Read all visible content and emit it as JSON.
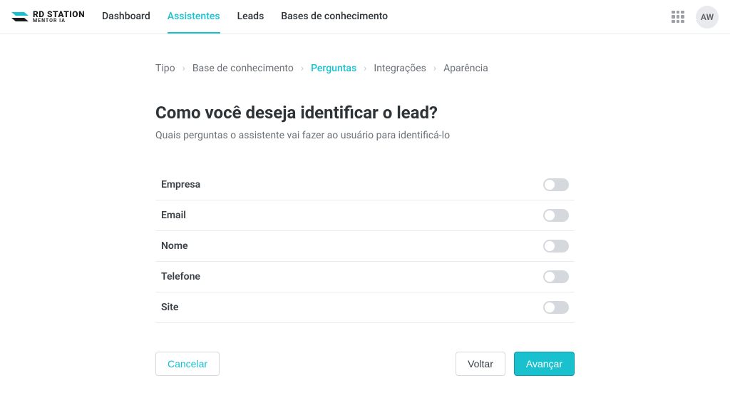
{
  "brand": {
    "name": "RD STATION",
    "subtitle": "MENTOR IA"
  },
  "nav": {
    "items": [
      {
        "label": "Dashboard",
        "active": false
      },
      {
        "label": "Assistentes",
        "active": true
      },
      {
        "label": "Leads",
        "active": false
      },
      {
        "label": "Bases de conhecimento",
        "active": false
      }
    ]
  },
  "user": {
    "initials": "AW"
  },
  "breadcrumb": {
    "items": [
      {
        "label": "Tipo",
        "active": false
      },
      {
        "label": "Base de conhecimento",
        "active": false
      },
      {
        "label": "Perguntas",
        "active": true
      },
      {
        "label": "Integrações",
        "active": false
      },
      {
        "label": "Aparência",
        "active": false
      }
    ]
  },
  "page": {
    "title": "Como você deseja identificar o lead?",
    "subtitle": "Quais perguntas o assistente vai fazer ao usuário para identificá-lo"
  },
  "fields": [
    {
      "label": "Empresa",
      "enabled": false
    },
    {
      "label": "Email",
      "enabled": false
    },
    {
      "label": "Nome",
      "enabled": false
    },
    {
      "label": "Telefone",
      "enabled": false
    },
    {
      "label": "Site",
      "enabled": false
    }
  ],
  "buttons": {
    "cancel": "Cancelar",
    "back": "Voltar",
    "next": "Avançar"
  }
}
